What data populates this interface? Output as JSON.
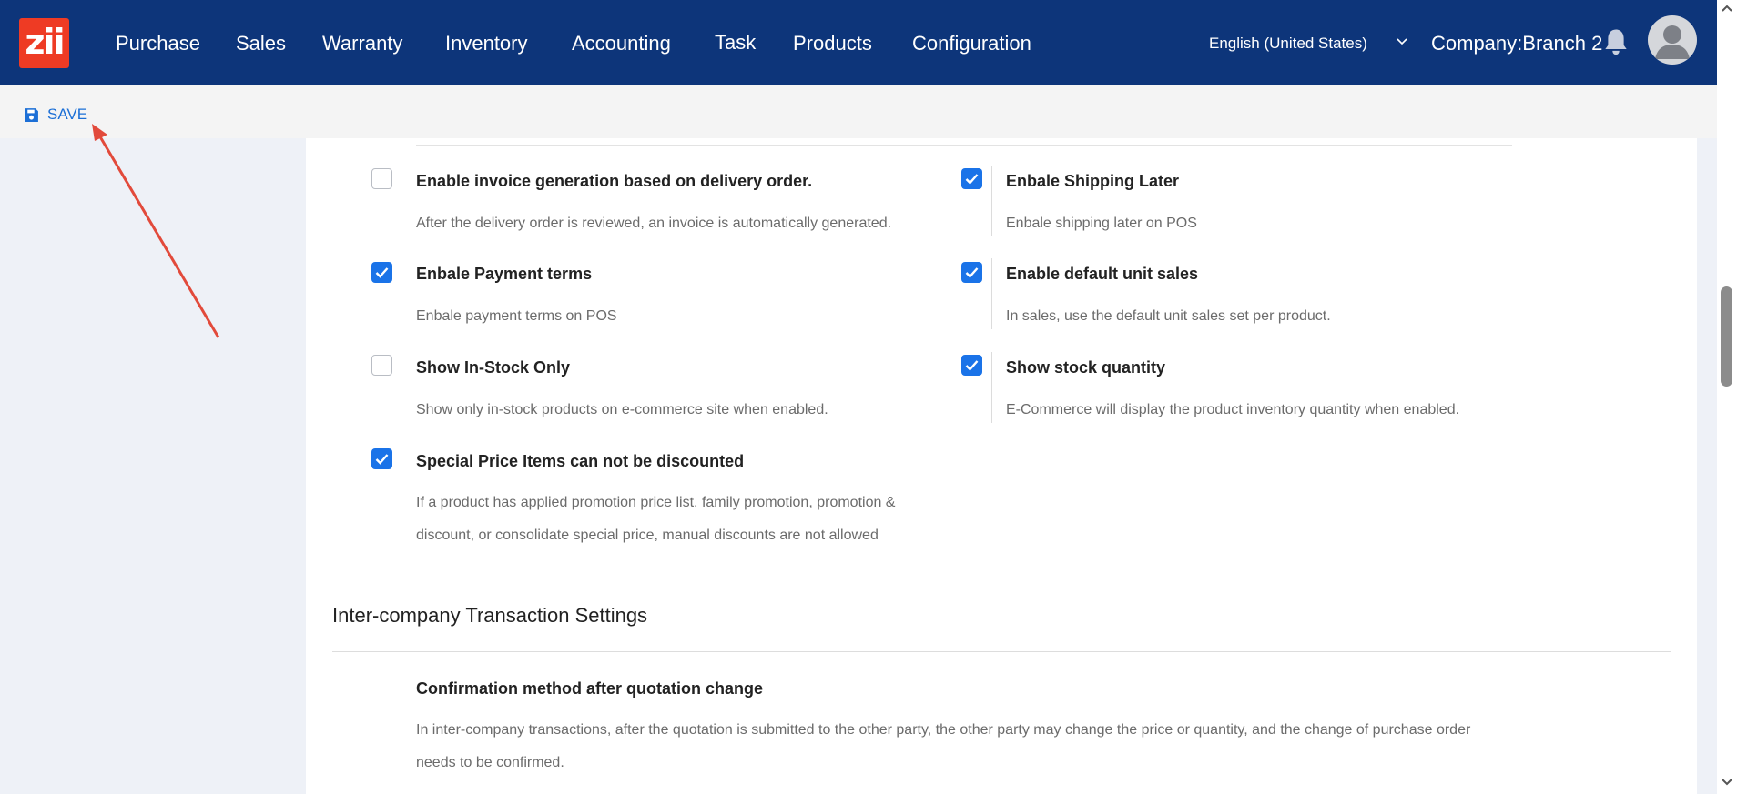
{
  "brand": {
    "logo_text": "zii",
    "logo_color": "#ee3b24",
    "nav_color": "#0d357a"
  },
  "nav": {
    "items": [
      "Purchase",
      "Sales",
      "Warranty",
      "Inventory",
      "Accounting",
      "Task",
      "Products",
      "Configuration"
    ],
    "language": "English (United States)",
    "company": "Company:Branch 2",
    "icons": [
      "chevron-down-icon",
      "bell-icon",
      "avatar"
    ]
  },
  "toolbar": {
    "save_label": "SAVE",
    "save_icon": "floppy-disk-icon",
    "accent": "#1c6fd6"
  },
  "settings": [
    {
      "title": "Enable invoice generation based on delivery order.",
      "desc": "After the delivery order is reviewed, an invoice is automatically generated.",
      "checked": false
    },
    {
      "title": "Enbale Shipping Later",
      "desc": "Enbale shipping later on POS",
      "checked": true
    },
    {
      "title": "Enbale Payment terms",
      "desc": "Enbale payment terms on POS",
      "checked": true
    },
    {
      "title": "Enable default unit sales",
      "desc": "In sales, use the default unit sales set per product.",
      "checked": true
    },
    {
      "title": "Show In-Stock Only",
      "desc": "Show only in-stock products on e-commerce site when enabled.",
      "checked": false
    },
    {
      "title": "Show stock quantity",
      "desc": "E-Commerce will display the product inventory quantity when enabled.",
      "checked": true
    },
    {
      "title": "Special Price Items can not be discounted",
      "desc_lines": [
        "If a product has applied promotion price list, family promotion, promotion &",
        "discount, or consolidate special price, manual discounts are not allowed"
      ],
      "checked": true
    }
  ],
  "intercompany": {
    "section_title": "Inter-company Transaction Settings",
    "setting_title": "Confirmation method after quotation change",
    "desc_lines": [
      "In inter-company transactions, after the quotation is submitted to the other party, the other party may change the price or quantity, and the change of purchase order",
      "needs to be confirmed."
    ]
  }
}
